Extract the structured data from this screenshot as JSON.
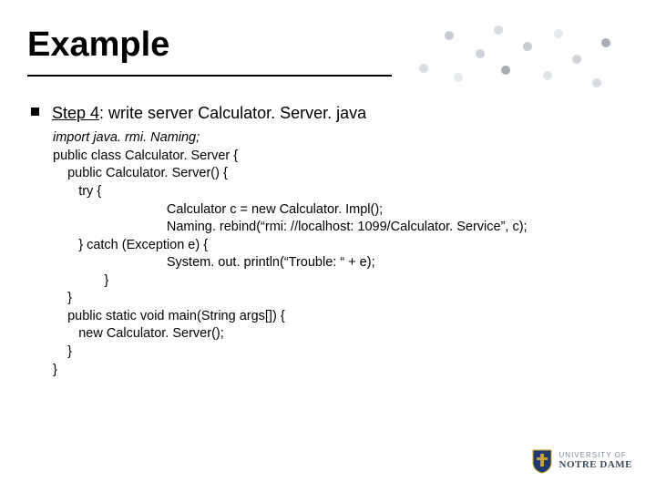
{
  "title": "Example",
  "step": {
    "label": "Step 4",
    "text": ": write server Calculator. Server. java"
  },
  "code": {
    "l1": "import java. rmi. Naming;",
    "l2": "public class Calculator. Server {",
    "l3": "    public Calculator. Server() {",
    "l4": "       try {",
    "l5": "                               Calculator c = new Calculator. Impl();",
    "l6": "                               Naming. rebind(“rmi: //localhost: 1099/Calculator. Service”, c);",
    "l7": "       } catch (Exception e) {",
    "l8": "                               System. out. println(“Trouble: “ + e);",
    "l9": "              }",
    "l10": "    }",
    "l11": "    public static void main(String args[]) {",
    "l12": "       new Calculator. Server();",
    "l13": "    }",
    "l14": "}"
  },
  "logo": {
    "line1": "UNIVERSITY OF",
    "line2": "NOTRE DAME"
  },
  "decor": {
    "colors": {
      "c1": "#d9dde1",
      "c2": "#c8ccd1",
      "c3": "#e6e9ec",
      "c4": "#cfd3d8",
      "c5": "#a7aeb5",
      "c6": "#e0e3e7"
    }
  }
}
